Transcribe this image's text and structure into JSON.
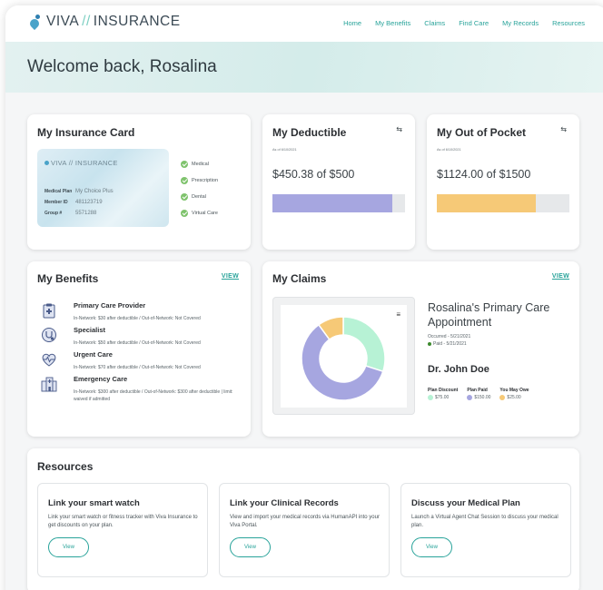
{
  "brand": {
    "name_left": "VIVA",
    "separator": "//",
    "name_right": "INSURANCE",
    "teal": "#28a39a"
  },
  "nav": {
    "links": [
      "Home",
      "My Benefits",
      "Claims",
      "Find Care",
      "My Records",
      "Resources"
    ]
  },
  "welcome": {
    "text": "Welcome back, Rosalina"
  },
  "insurance_card": {
    "title": "My Insurance Card",
    "card_brand": "VIVA // INSURANCE",
    "fields": [
      {
        "label": "Medical Plan",
        "value": "My Choice Plus"
      },
      {
        "label": "Member ID",
        "value": "481123719"
      },
      {
        "label": "Group #",
        "value": "5571288"
      }
    ],
    "coverage": [
      "Medical",
      "Prescription",
      "Dental",
      "Virtual Care"
    ]
  },
  "deductible": {
    "title": "My Deductible",
    "as_of": "As of 6/10/2021",
    "amount_text": "$450.38 of $500",
    "spent": 450.38,
    "total": 500,
    "bar_color": "#a6a6e0"
  },
  "out_of_pocket": {
    "title": "My Out of Pocket",
    "as_of": "As of 6/10/2021",
    "amount_text": "$1124.00 of $1500",
    "spent": 1124.0,
    "total": 1500,
    "bar_color": "#f6c977"
  },
  "benefits": {
    "title": "My Benefits",
    "view_label": "VIEW",
    "items": [
      {
        "icon": "clipboard-medical-icon",
        "title": "Primary Care Provider",
        "desc": "In-Network: $30 after deductible / Out-of-Network: Not Covered"
      },
      {
        "icon": "stethoscope-badge-icon",
        "title": "Specialist",
        "desc": "In-Network: $50 after deductible / Out-of-Network: Not Covered"
      },
      {
        "icon": "heart-pulse-icon",
        "title": "Urgent Care",
        "desc": "In-Network: $70 after deductible / Out-of-Network: Not Covered"
      },
      {
        "icon": "hospital-building-icon",
        "title": "Emergency Care",
        "desc": "In-Network: $300 after deductible / Out-of-Network: $300 after deductible | limit: waived if admitted"
      }
    ]
  },
  "claims": {
    "title": "My Claims",
    "view_label": "VIEW",
    "menu_glyph": "≡",
    "claim_title": "Rosalina's Primary Care Appointment",
    "occurred": "Occurred - 5/21/2021",
    "paid": "Paid - 5/21/2021",
    "doctor": "Dr. John Doe",
    "breakdown": [
      {
        "label": "Plan Discount",
        "value": "$75.00",
        "amount": 75,
        "color": "#b7f2d5"
      },
      {
        "label": "Plan Paid",
        "value": "$150.00",
        "amount": 150,
        "color": "#a6a6e0"
      },
      {
        "label": "You May Owe",
        "value": "$25.00",
        "amount": 25,
        "color": "#f6c977"
      }
    ]
  },
  "resources": {
    "title": "Resources",
    "items": [
      {
        "title": "Link your smart watch",
        "desc": "Link your smart watch or fitness tracker with Viva Insurance to get discounts on your plan.",
        "button": "View"
      },
      {
        "title": "Link your Clinical Records",
        "desc": "View and import your medical records via HumanAPI into your Viva Portal.",
        "button": "View"
      },
      {
        "title": "Discuss your Medical Plan",
        "desc": "Launch a Virtual Agent Chat Session to discuss your medical plan.",
        "button": "View"
      }
    ]
  }
}
